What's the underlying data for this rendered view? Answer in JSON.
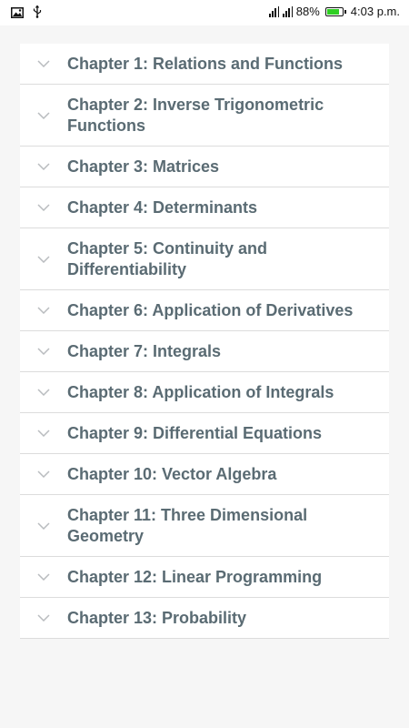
{
  "status_bar": {
    "left_icons": [
      "image-icon",
      "usb-icon"
    ],
    "battery_percent": "88%",
    "battery_level": 0.88,
    "time": "4:03 p.m."
  },
  "chapters": [
    {
      "label": "Chapter 1: Relations and Functions",
      "icon": "chevron-down-icon"
    },
    {
      "label": "Chapter 2: Inverse Trigonometric Functions",
      "icon": "chevron-down-icon"
    },
    {
      "label": "Chapter 3: Matrices",
      "icon": "chevron-down-icon"
    },
    {
      "label": "Chapter 4: Determinants",
      "icon": "chevron-down-icon"
    },
    {
      "label": "Chapter 5: Continuity and Differentiability",
      "icon": "chevron-down-icon"
    },
    {
      "label": "Chapter 6: Application of Derivatives",
      "icon": "chevron-down-icon"
    },
    {
      "label": "Chapter 7: Integrals",
      "icon": "chevron-down-icon"
    },
    {
      "label": "Chapter 8: Application of Integrals",
      "icon": "chevron-down-icon"
    },
    {
      "label": "Chapter 9: Differential Equations",
      "icon": "chevron-down-icon"
    },
    {
      "label": "Chapter 10: Vector Algebra",
      "icon": "chevron-down-icon"
    },
    {
      "label": "Chapter 11: Three Dimensional Geometry",
      "icon": "chevron-down-icon"
    },
    {
      "label": "Chapter 12: Linear Programming",
      "icon": "chevron-down-icon"
    },
    {
      "label": "Chapter 13: Probability",
      "icon": "chevron-down-icon"
    }
  ],
  "colors": {
    "label_text": "#5a6b73",
    "chevron": "#b9bcbf",
    "divider": "#dcdcdc",
    "background": "#f6f6f6",
    "battery_fill": "#2fcf23"
  }
}
